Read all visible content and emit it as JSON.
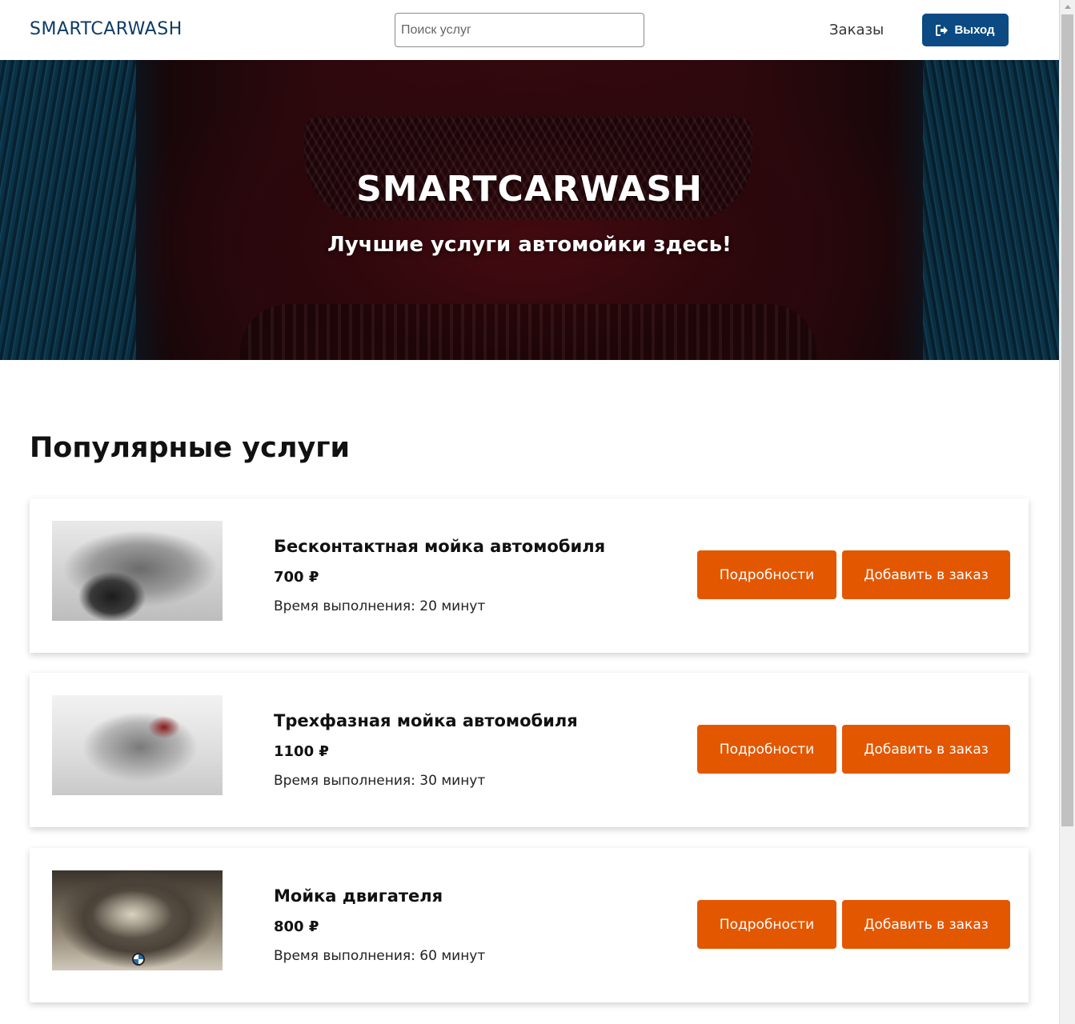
{
  "header": {
    "brand": "SMARTCARWASH",
    "search_placeholder": "Поиск услуг",
    "nav_orders": "Заказы",
    "logout_label": "Выход",
    "logout_icon": "sign-out-icon",
    "colors": {
      "brand": "#0d3b66",
      "logout_bg": "#0b4a82"
    }
  },
  "hero": {
    "title": "SMARTCARWASH",
    "subtitle": "Лучшие услуги автомойки здесь!"
  },
  "section": {
    "title": "Популярные услуги"
  },
  "services": [
    {
      "name": "Бесконтактная мойка автомобиля",
      "price": "700 ₽",
      "time": "Время выполнения: 20 минут",
      "details_label": "Подробности",
      "add_label": "Добавить в заказ"
    },
    {
      "name": "Трехфазная мойка автомобиля",
      "price": "1100 ₽",
      "time": "Время выполнения: 30 минут",
      "details_label": "Подробности",
      "add_label": "Добавить в заказ"
    },
    {
      "name": "Мойка двигателя",
      "price": "800 ₽",
      "time": "Время выполнения: 60 минут",
      "details_label": "Подробности",
      "add_label": "Добавить в заказ"
    }
  ],
  "colors": {
    "accent_button": "#e35700"
  }
}
